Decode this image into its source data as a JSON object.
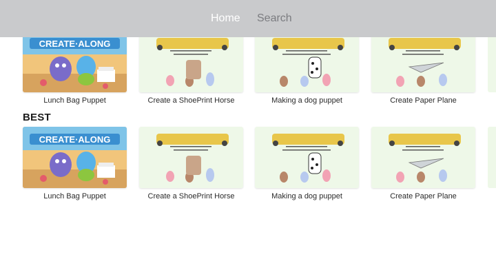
{
  "nav": {
    "tabs": [
      {
        "label": "Home",
        "active": true
      },
      {
        "label": "Search",
        "active": false
      }
    ]
  },
  "rows": [
    {
      "title": "",
      "items": [
        {
          "title": "Lunch Bag Puppet",
          "thumbnail": "create-along"
        },
        {
          "title": "Create a ShoePrint Horse",
          "thumbnail": "angels-attic"
        },
        {
          "title": "Making a dog puppet",
          "thumbnail": "angels-attic"
        },
        {
          "title": "Create Paper Plane",
          "thumbnail": "angels-attic"
        }
      ]
    },
    {
      "title": "BEST",
      "items": [
        {
          "title": "Lunch Bag Puppet",
          "thumbnail": "create-along"
        },
        {
          "title": "Create a ShoePrint Horse",
          "thumbnail": "angels-attic"
        },
        {
          "title": "Making a dog puppet",
          "thumbnail": "angels-attic"
        },
        {
          "title": "Create Paper Plane",
          "thumbnail": "angels-attic"
        }
      ]
    }
  ],
  "colors": {
    "topbar": "#c9cacc",
    "active_tab": "#ffffff",
    "inactive_tab": "#7b7c80",
    "thumb_bg": "#eef8e8"
  }
}
